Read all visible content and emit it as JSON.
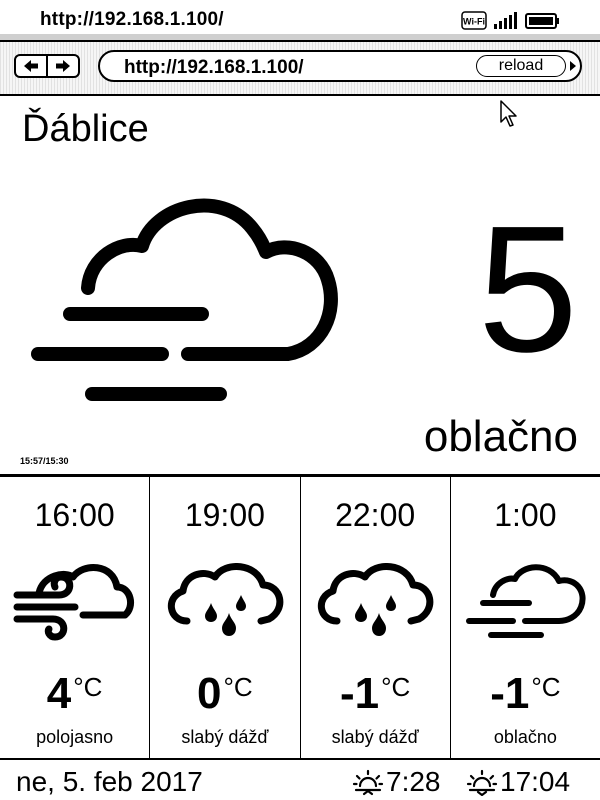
{
  "status_bar": {
    "url": "http://192.168.1.100/",
    "wifi_icon": "wifi-icon",
    "signal_icon": "signal-bars-icon",
    "battery_icon": "battery-icon"
  },
  "browser": {
    "back_icon": "back-arrow-icon",
    "forward_icon": "forward-arrow-icon",
    "url": "http://192.168.1.100/",
    "reload_label": "reload"
  },
  "current": {
    "city": "Ďáblice",
    "temperature": "5",
    "condition": "oblačno",
    "icon": "cloud-fog-icon",
    "updated": "15:57/15:30"
  },
  "forecast": [
    {
      "time": "16:00",
      "temp": "4",
      "unit": "°C",
      "condition": "polojasno",
      "icon": "cloud-wind-icon"
    },
    {
      "time": "19:00",
      "temp": "0",
      "unit": "°C",
      "condition": "slabý dážď",
      "icon": "cloud-rain-icon"
    },
    {
      "time": "22:00",
      "temp": "-1",
      "unit": "°C",
      "condition": "slabý dážď",
      "icon": "cloud-rain-icon"
    },
    {
      "time": "1:00",
      "temp": "-1",
      "unit": "°C",
      "condition": "oblačno",
      "icon": "cloud-fog-icon"
    }
  ],
  "footer": {
    "date": "ne, 5. feb 2017",
    "sunrise": "7:28",
    "sunset": "17:04"
  }
}
